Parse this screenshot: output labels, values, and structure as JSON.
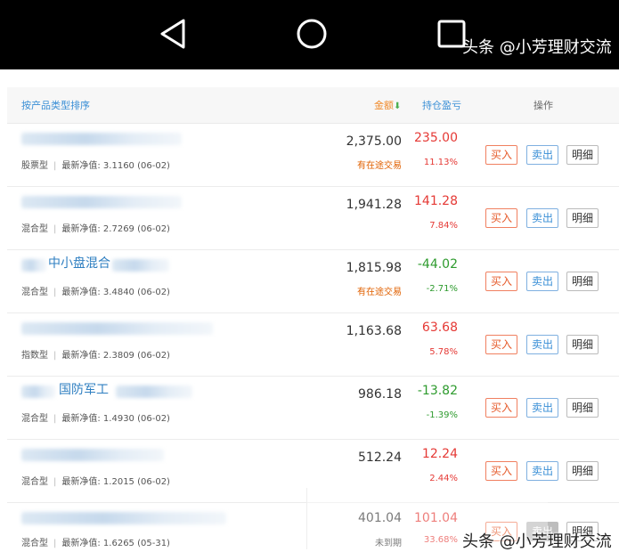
{
  "watermark": "头条 @小芳理财交流",
  "header": {
    "sort": "按产品类型排序",
    "amount": "金额",
    "amount_arrow": "⬇",
    "profit": "持仓盈亏",
    "action": "操作"
  },
  "buttons": {
    "buy": "买入",
    "sell": "卖出",
    "detail": "明细"
  },
  "rows": [
    {
      "name": "",
      "type": "股票型",
      "nav": "最新净值: 3.1160 (06-02)",
      "amount": "2,375.00",
      "status": "有在途交易",
      "profit": "235.00",
      "pct": "11.13%"
    },
    {
      "name": "",
      "type": "混合型",
      "nav": "最新净值: 2.7269 (06-02)",
      "amount": "1,941.28",
      "status": "",
      "profit": "141.28",
      "pct": "7.84%"
    },
    {
      "name": "中小盘混合",
      "type": "混合型",
      "nav": "最新净值: 3.4840 (06-02)",
      "amount": "1,815.98",
      "status": "有在途交易",
      "profit": "-44.02",
      "pct": "-2.71%"
    },
    {
      "name": "",
      "type": "指数型",
      "nav": "最新净值: 2.3809 (06-02)",
      "amount": "1,163.68",
      "status": "",
      "profit": "63.68",
      "pct": "5.78%"
    },
    {
      "name": "国防军工",
      "type": "混合型",
      "nav": "最新净值: 1.4930 (06-02)",
      "amount": "986.18",
      "status": "",
      "profit": "-13.82",
      "pct": "-1.39%"
    },
    {
      "name": "",
      "type": "混合型",
      "nav": "最新净值: 1.2015 (06-02)",
      "amount": "512.24",
      "status": "",
      "profit": "12.24",
      "pct": "2.44%"
    },
    {
      "name": "",
      "type": "混合型",
      "nav": "最新净值: 1.6265 (05-31)",
      "amount": "401.04",
      "status": "未到期",
      "profit": "101.04",
      "pct": "33.68%"
    }
  ]
}
